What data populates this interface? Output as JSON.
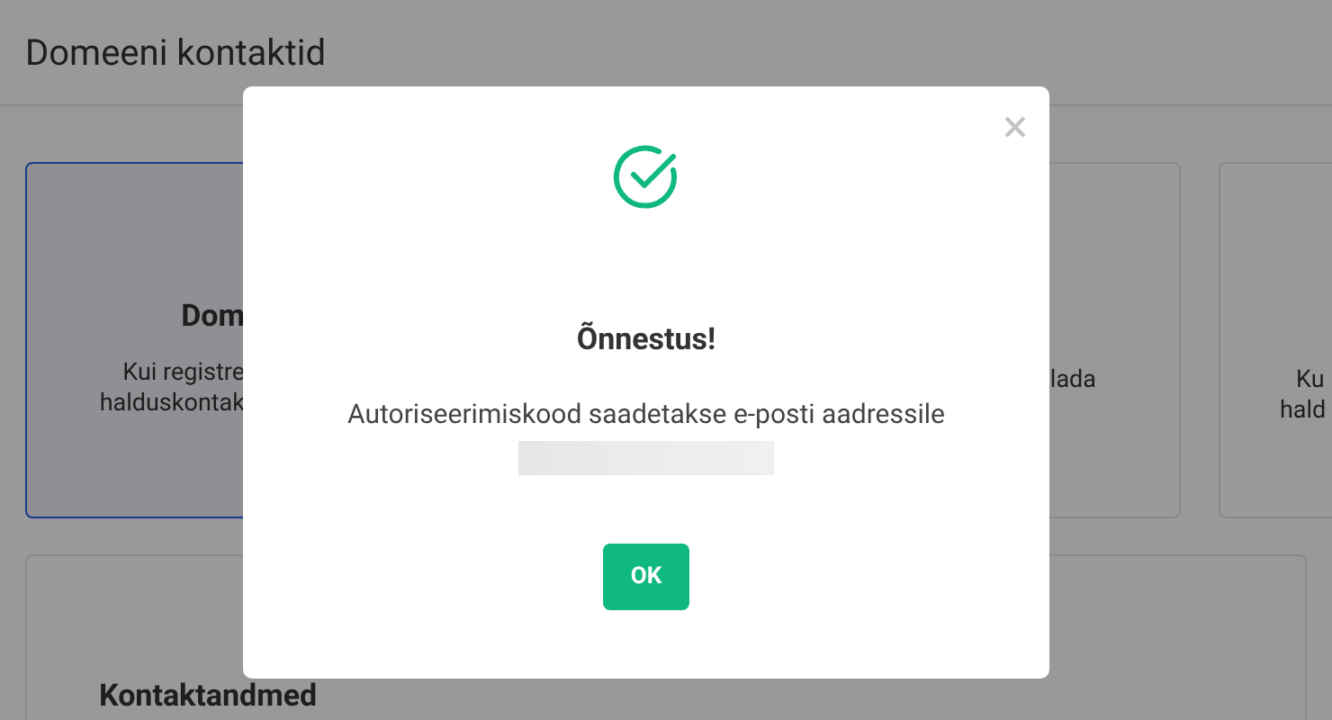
{
  "page": {
    "title": "Domeeni kontaktid"
  },
  "cards": [
    {
      "title": "Dom",
      "lines": [
        "Kui registre",
        "halduskontak"
      ],
      "selected": true
    },
    {
      "lines": [
        "lada"
      ],
      "selected": false
    },
    {
      "lines": [
        "Ku",
        "hald"
      ],
      "selected": false
    }
  ],
  "section": {
    "title": "Kontaktandmed"
  },
  "dialog": {
    "title": "Õnnestus!",
    "message": "Autoriseerimiskood saadetakse e-posti aadressile",
    "close": "×",
    "button": "OK"
  }
}
